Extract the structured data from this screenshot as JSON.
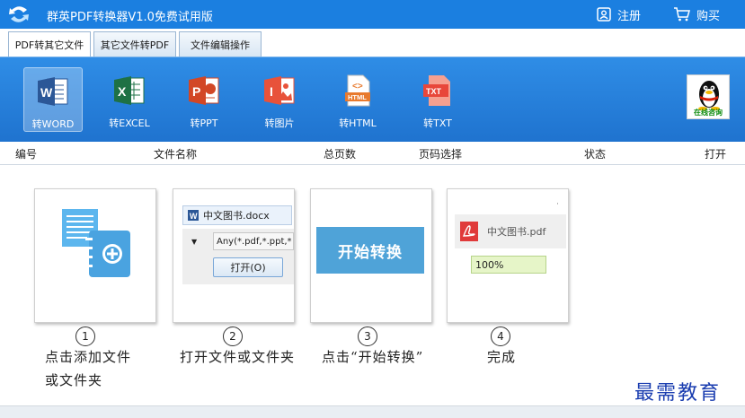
{
  "titlebar": {
    "title": "群英PDF转换器V1.0免费试用版",
    "register_label": "注册",
    "buy_label": "购买"
  },
  "tabs": [
    {
      "label": "PDF转其它文件",
      "active": true
    },
    {
      "label": "其它文件转PDF",
      "active": false
    },
    {
      "label": "文件编辑操作",
      "active": false
    }
  ],
  "ribbon": {
    "tools": [
      {
        "label": "转WORD",
        "icon": "word-icon",
        "color": "#2b5797",
        "selected": true
      },
      {
        "label": "转EXCEL",
        "icon": "excel-icon",
        "color": "#1e7145",
        "selected": false
      },
      {
        "label": "转PPT",
        "icon": "ppt-icon",
        "color": "#d24726",
        "selected": false
      },
      {
        "label": "转图片",
        "icon": "image-icon",
        "color": "#e8523a",
        "selected": false
      },
      {
        "label": "转HTML",
        "icon": "html-icon",
        "color": "#e87a2e",
        "selected": false
      },
      {
        "label": "转TXT",
        "icon": "txt-icon",
        "color": "#e8473a",
        "selected": false
      }
    ],
    "qq_label": "在线咨询"
  },
  "columns": {
    "number": "编号",
    "filename": "文件名称",
    "total_pages": "总页数",
    "page_select": "页码选择",
    "status": "状态",
    "open": "打开"
  },
  "guide": {
    "steps": [
      "1",
      "2",
      "3",
      "4"
    ],
    "step1_caption_line1": "点击添加文件",
    "step1_caption_line2": "或文件夹",
    "step2_caption": "打开文件或文件夹",
    "step3_caption": "点击“开始转换”",
    "step4_caption": "完成",
    "step2_filename": "中文图书.docx",
    "step2_filter": "Any(*.pdf,*.ppt,*",
    "step2_open_button": "打开(O)",
    "step3_button": "开始转换",
    "step4_filename": "中文图书.pdf",
    "step4_progress": "100%"
  },
  "watermark": "最需教育"
}
